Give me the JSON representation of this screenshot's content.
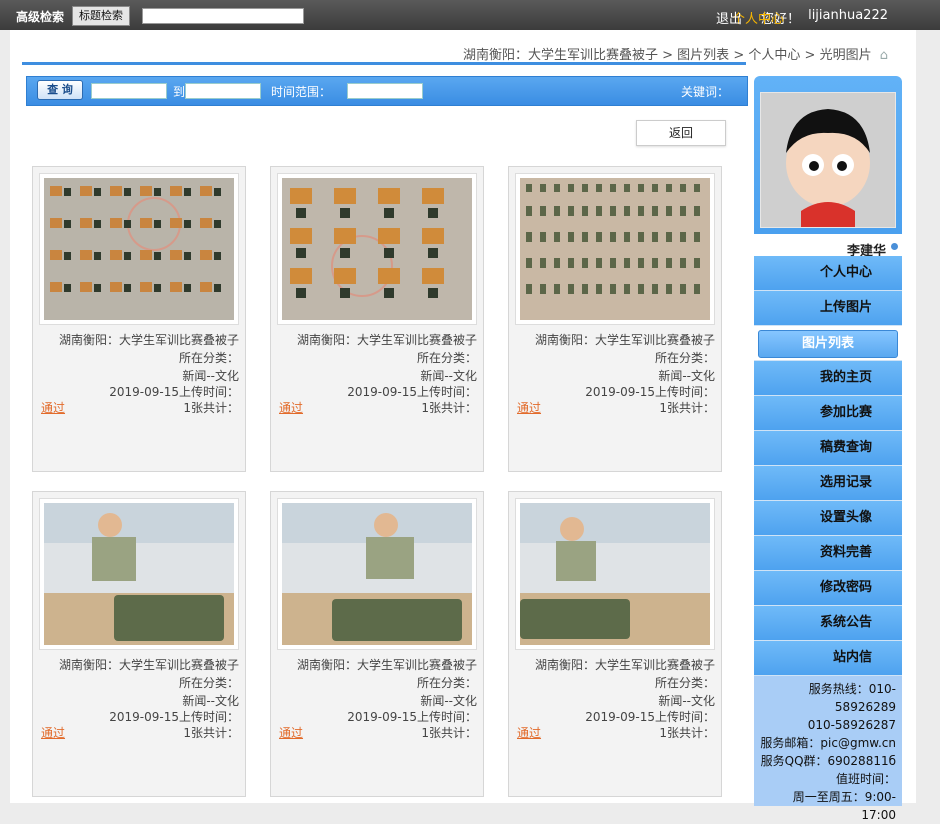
{
  "topbar": {
    "username": "lijianhua222",
    "welcome": "您好！",
    "user_center": "个人中心",
    "logout": "退出",
    "search_title_btn": "标题检索",
    "advanced_search": "高级检索"
  },
  "breadcrumb": {
    "items": [
      "光明图片",
      "个人中心",
      "图片列表",
      "湖南衡阳：大学生军训比赛叠被子"
    ],
    "sep": ">"
  },
  "filter": {
    "keyword_label": "关键词：",
    "time_label": "时间范围：",
    "to_label": "到",
    "query_button": "查 询"
  },
  "back_button": "返回",
  "cards": [
    {
      "title": "湖南衡阳：大学生军训比赛叠被子",
      "category_label": "所在分类：",
      "category": "新闻--文化",
      "upload_label": "上传时间：",
      "upload_date": "2019-09-15",
      "count_label": "共计：",
      "count": "1张",
      "status": "通过"
    },
    {
      "title": "湖南衡阳：大学生军训比赛叠被子",
      "category_label": "所在分类：",
      "category": "新闻--文化",
      "upload_label": "上传时间：",
      "upload_date": "2019-09-15",
      "count_label": "共计：",
      "count": "1张",
      "status": "通过"
    },
    {
      "title": "湖南衡阳：大学生军训比赛叠被子",
      "category_label": "所在分类：",
      "category": "新闻--文化",
      "upload_label": "上传时间：",
      "upload_date": "2019-09-15",
      "count_label": "共计：",
      "count": "1张",
      "status": "通过"
    },
    {
      "title": "湖南衡阳：大学生军训比赛叠被子",
      "category_label": "所在分类：",
      "category": "新闻--文化",
      "upload_label": "上传时间：",
      "upload_date": "2019-09-15",
      "count_label": "共计：",
      "count": "1张",
      "status": "通过"
    },
    {
      "title": "湖南衡阳：大学生军训比赛叠被子",
      "category_label": "所在分类：",
      "category": "新闻--文化",
      "upload_label": "上传时间：",
      "upload_date": "2019-09-15",
      "count_label": "共计：",
      "count": "1张",
      "status": "通过"
    },
    {
      "title": "湖南衡阳：大学生军训比赛叠被子",
      "category_label": "所在分类：",
      "category": "新闻--文化",
      "upload_label": "上传时间：",
      "upload_date": "2019-09-15",
      "count_label": "共计：",
      "count": "1张",
      "status": "通过"
    }
  ],
  "sidebar": {
    "user_name": "李建华",
    "menu": [
      "个人中心",
      "上传图片",
      "图片列表",
      "我的主页",
      "参加比赛",
      "稿费查询",
      "选用记录",
      "设置头像",
      "资料完善",
      "修改密码",
      "系统公告",
      "站内信"
    ],
    "contact": [
      "服务热线：010-",
      "58926289",
      "010-58926287",
      "服务邮箱：pic@gmw.cn",
      "服务QQ群：69028811б",
      "值班时间：",
      "周一至周五：9:00-17:00"
    ]
  },
  "colors": {
    "accent": "#3e8ee0",
    "status": "#e26b2b",
    "highlight": "#f5b400"
  }
}
